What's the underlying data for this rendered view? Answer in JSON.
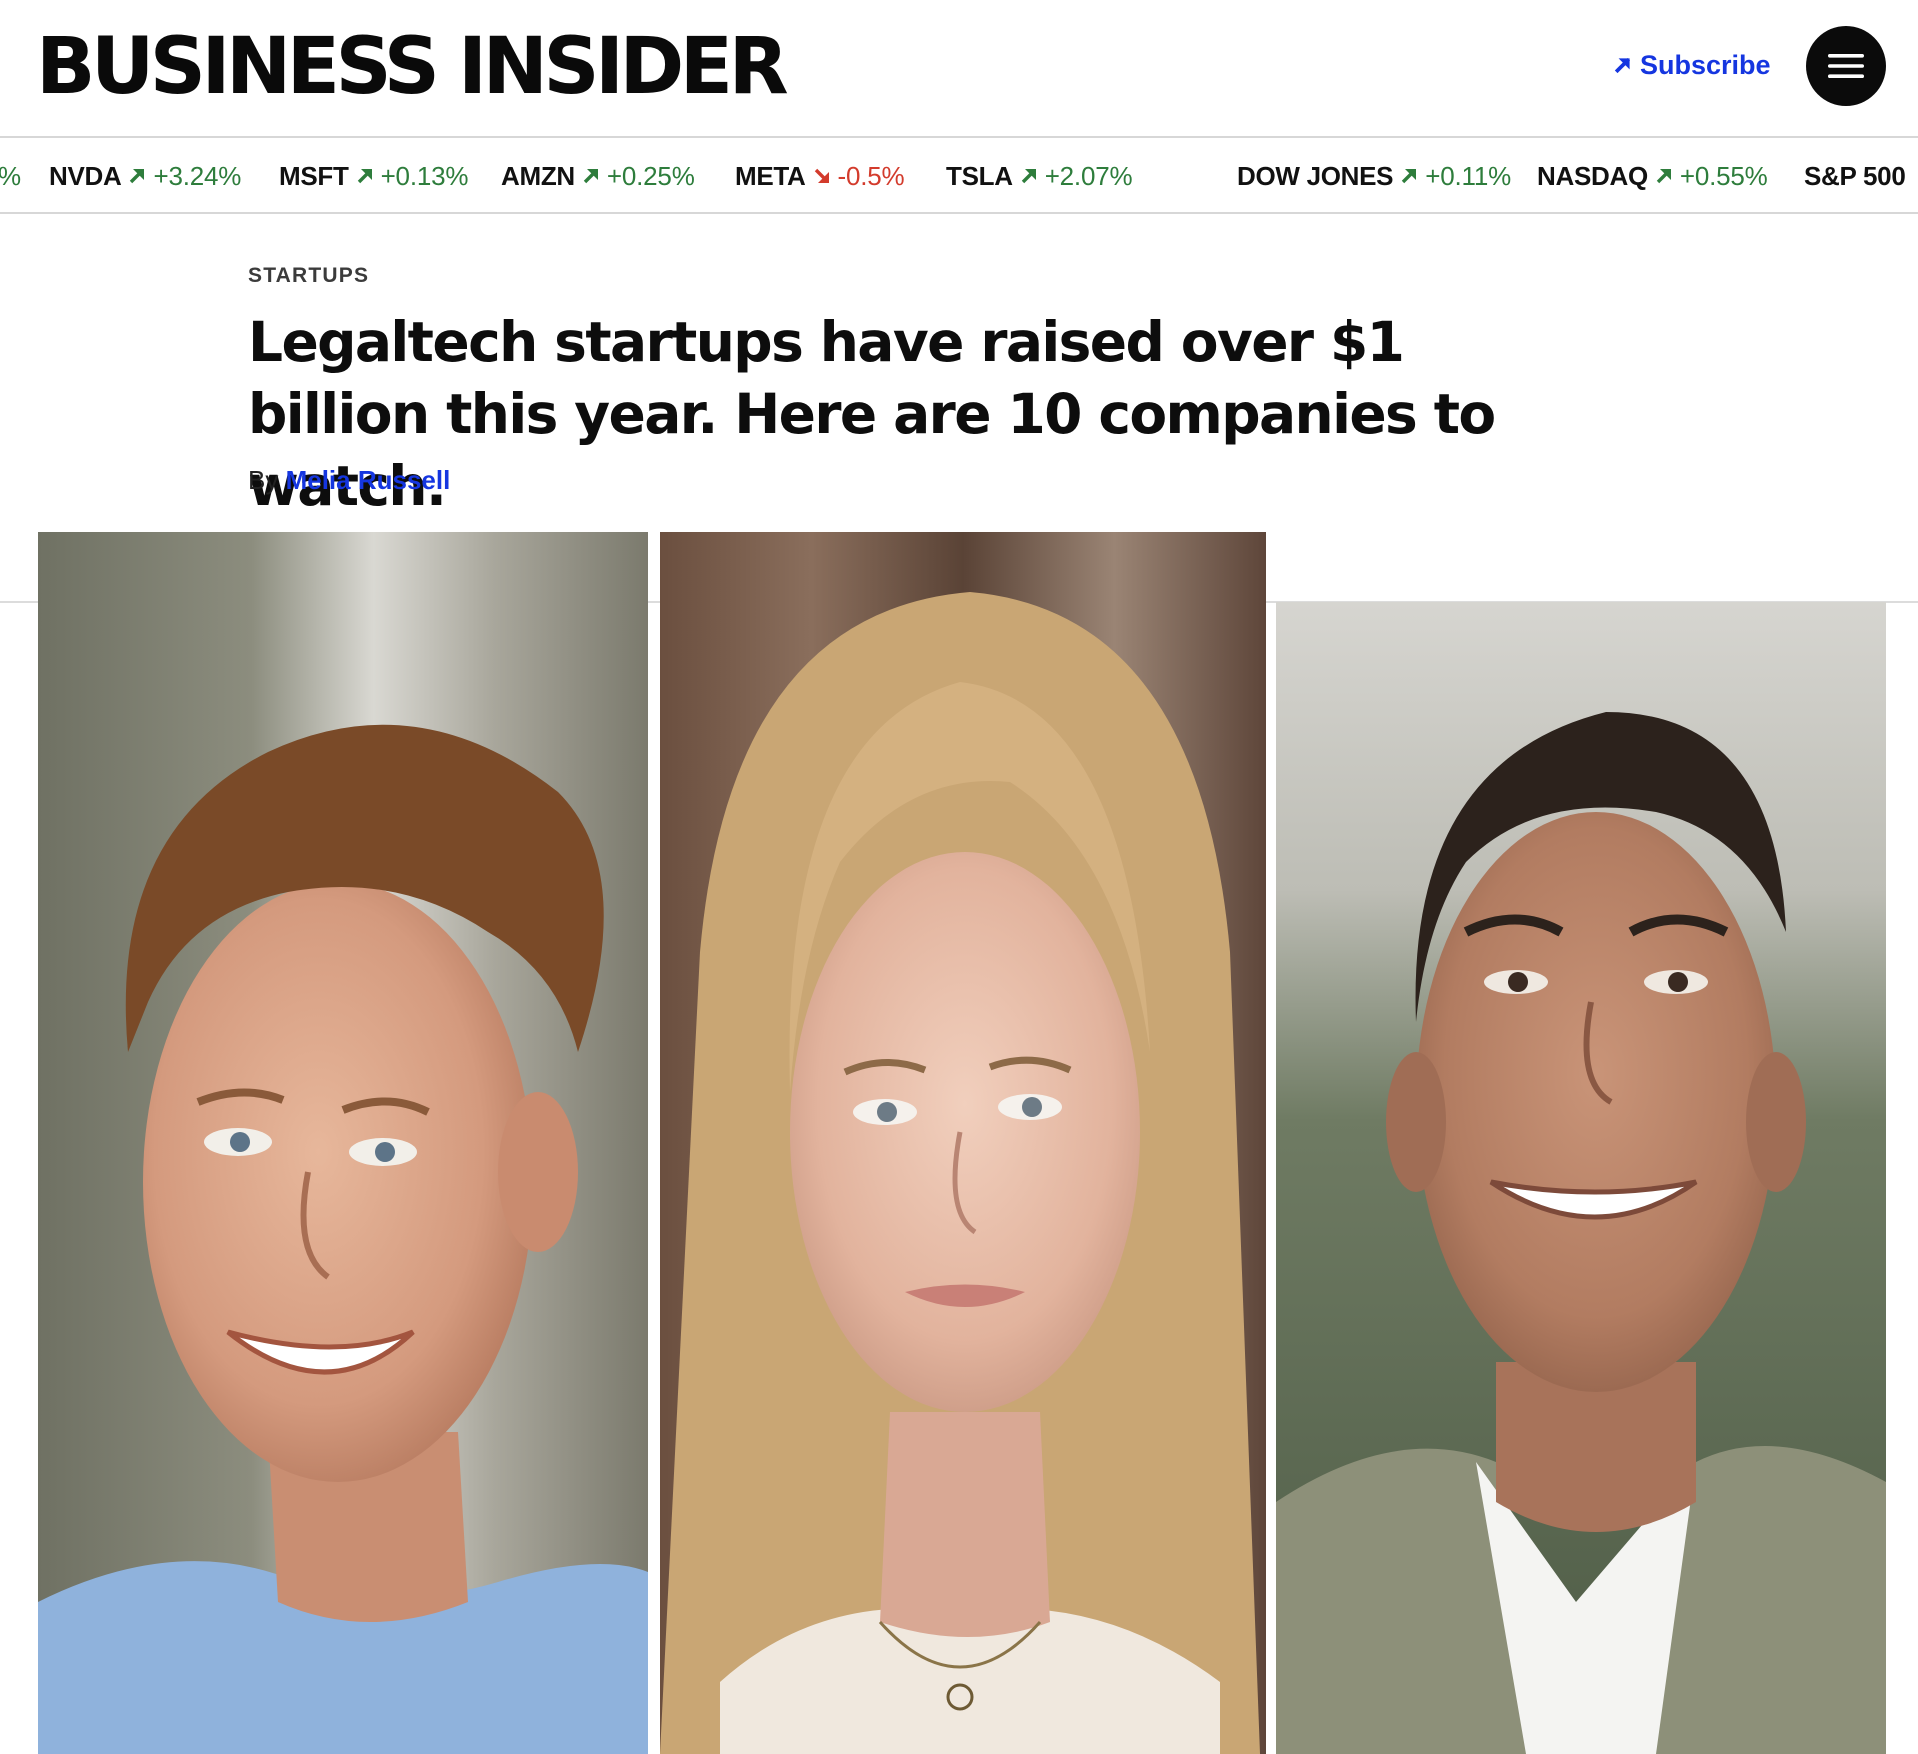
{
  "header": {
    "logo": "BUSINESS INSIDER",
    "subscribe_label": "Subscribe"
  },
  "ticker": {
    "items": [
      {
        "symbol": "",
        "change": "%",
        "direction": "up"
      },
      {
        "symbol": "NVDA",
        "change": "+3.24%",
        "direction": "up"
      },
      {
        "symbol": "MSFT",
        "change": "+0.13%",
        "direction": "up"
      },
      {
        "symbol": "AMZN",
        "change": "+0.25%",
        "direction": "up"
      },
      {
        "symbol": "META",
        "change": "-0.5%",
        "direction": "down"
      },
      {
        "symbol": "TSLA",
        "change": "+2.07%",
        "direction": "up"
      },
      {
        "symbol": "DOW JONES",
        "change": "+0.11%",
        "direction": "up"
      },
      {
        "symbol": "NASDAQ",
        "change": "+0.55%",
        "direction": "up"
      },
      {
        "symbol": "S&P 500",
        "change": "",
        "direction": "up"
      }
    ]
  },
  "article": {
    "category": "STARTUPS",
    "headline": "Legaltech startups have raised over $1 billion this year. Here are 10 companies to watch.",
    "byline_prefix": "By",
    "author": "Melia Russell"
  },
  "colors": {
    "brand_blue": "#1536e0",
    "up_green": "#2e7d3c",
    "down_red": "#d33b2c",
    "rule_gray": "#d7d7d7"
  },
  "icons": {
    "subscribe": "arrow-up-right-icon",
    "menu": "hamburger-menu-icon",
    "ticker_up": "arrow-up-right-icon",
    "ticker_down": "arrow-down-right-icon"
  }
}
